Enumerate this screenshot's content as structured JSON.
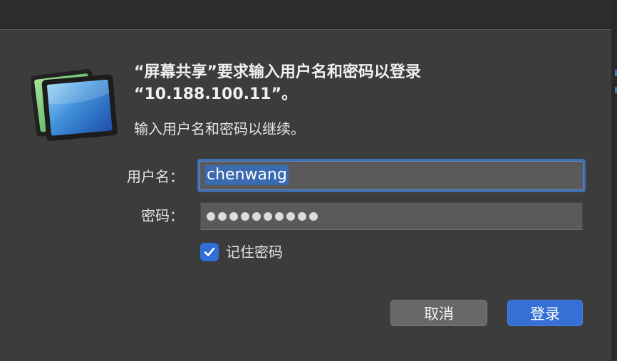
{
  "dialog": {
    "title_line1": "“屏幕共享”要求输入用户名和密码以登录",
    "title_line2": "“10.188.100.11”。",
    "subtitle": "输入用户名和密码以继续。"
  },
  "form": {
    "username_label": "用户名：",
    "username_value": "chenwang",
    "password_label": "密码：",
    "password_masked_length": 10,
    "remember_label": "记住密码",
    "remember_checked": true
  },
  "buttons": {
    "cancel_label": "取消",
    "login_label": "登录"
  },
  "colors": {
    "accent": "#3670d6",
    "dialog_bg": "#3c3c3c",
    "field_bg": "#5a5a5a"
  },
  "icons": {
    "app_icon": "screen-sharing-icon",
    "checkbox_mark": "checkmark-icon"
  }
}
